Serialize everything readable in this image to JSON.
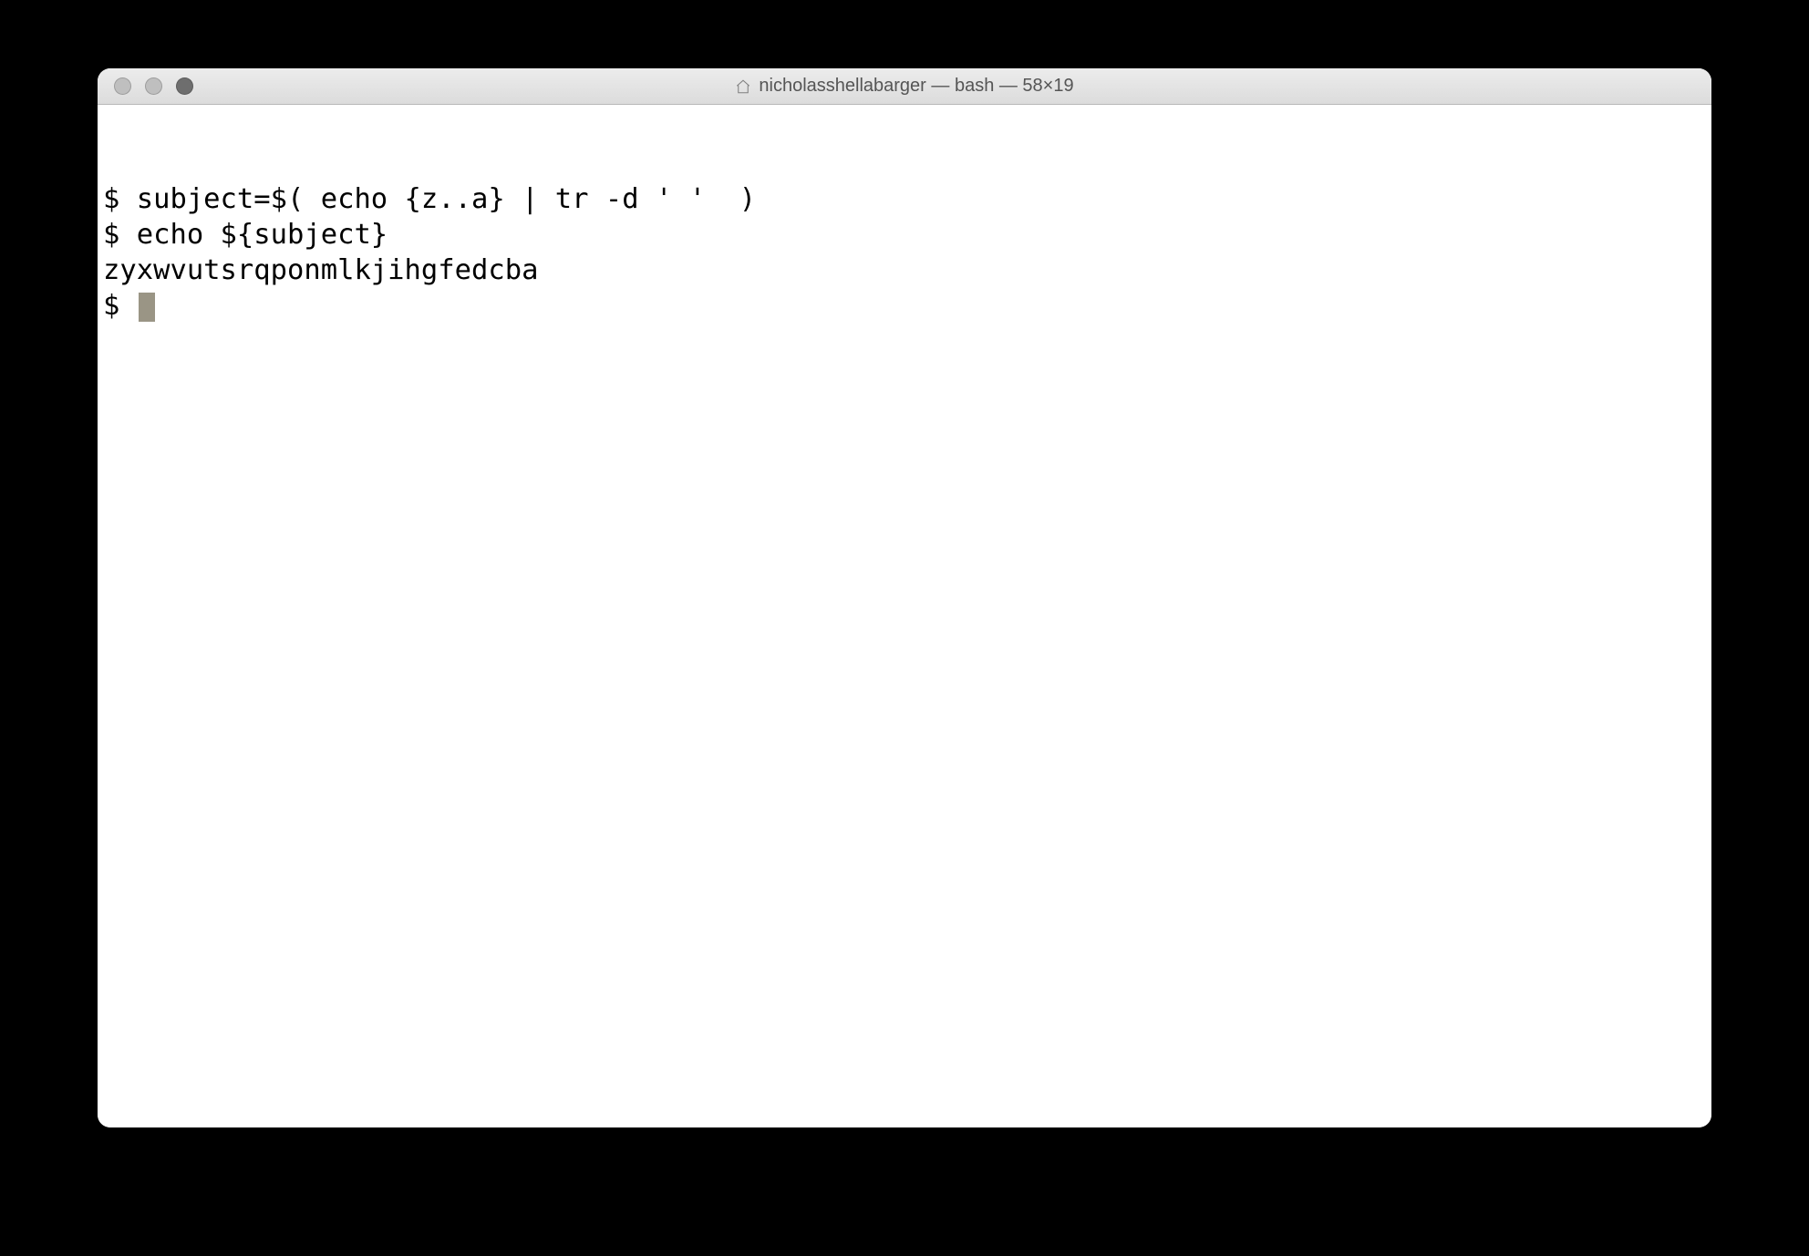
{
  "titlebar": {
    "title": "nicholasshellabarger — bash — 58×19",
    "home_icon": "home-icon"
  },
  "terminal": {
    "lines": [
      {
        "prompt": "$ ",
        "text": "subject=$( echo {z..a} | tr -d ' '  )"
      },
      {
        "prompt": "$ ",
        "text": "echo ${subject}"
      },
      {
        "prompt": "",
        "text": "zyxwvutsrqponmlkjihgfedcba"
      },
      {
        "prompt": "$ ",
        "text": "",
        "cursor": true
      }
    ]
  }
}
